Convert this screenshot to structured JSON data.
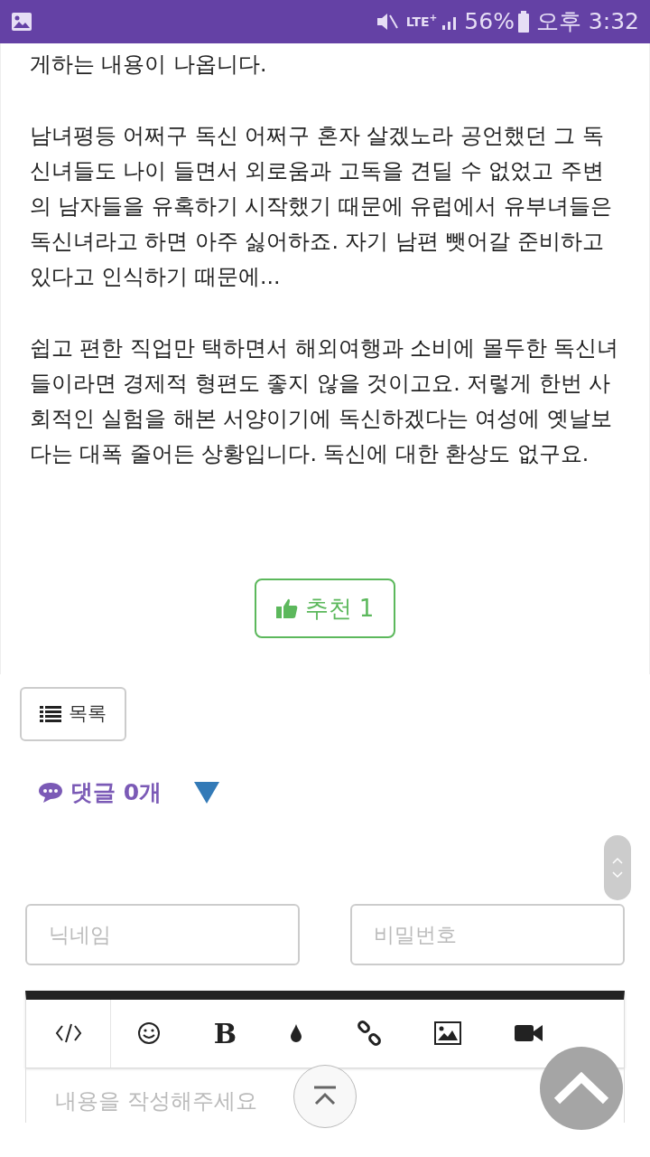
{
  "status_bar": {
    "network": "LTE$^{+}$",
    "battery": "56%",
    "time": "오후 3:32"
  },
  "article": {
    "paragraphs": [
      "게하는 내용이 나옵니다.",
      "남녀평등 어쩌구 독신 어쩌구 혼자 살겠노라 공언했던 그 독신녀들도 나이 들면서 외로움과 고독을 견딜 수 없었고 주변의 남자들을 유혹하기 시작했기 때문에 유럽에서 유부녀들은 독신녀라고 하면 아주 싫어하죠. 자기 남편 뺏어갈 준비하고 있다고 인식하기 때문에...",
      "쉽고 편한 직업만 택하면서 해외여행과 소비에 몰두한 독신녀들이라면 경제적 형편도 좋지 않을 것이고요. 저렇게 한번 사회적인 실험을 해본 서양이기에 독신하겠다는 여성에 옛날보다는 대폭 줄어든 상황입니다. 독신에 대한 환상도 없구요."
    ],
    "recommend": "추천 1"
  },
  "list_button": "목록",
  "comments": {
    "label": "댓글 0개",
    "expanded": true
  },
  "form": {
    "nickname_placeholder": "닉네임",
    "password_placeholder": "비밀번호"
  },
  "editor": {
    "bold_label": "B",
    "placeholder": "내용을 작성해주세요"
  }
}
